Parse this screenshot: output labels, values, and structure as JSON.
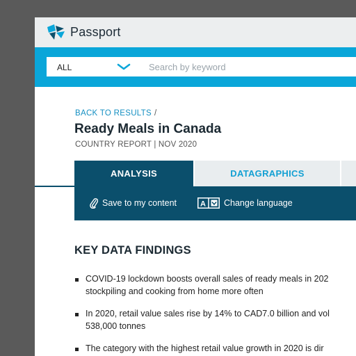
{
  "brand": {
    "name": "Passport"
  },
  "search": {
    "category": "ALL",
    "placeholder": "Search by keyword"
  },
  "breadcrumb": {
    "back_label": "BACK TO RESULTS",
    "separator": "/"
  },
  "report": {
    "title": "Ready Meals in Canada",
    "meta": "COUNTRY REPORT | NOV 2020"
  },
  "tabs": [
    {
      "label": "ANALYSIS",
      "active": true
    },
    {
      "label": "DATAGRAPHICS",
      "active": false
    }
  ],
  "actions": {
    "save": "Save to my content",
    "language": "Change language"
  },
  "section": {
    "heading": "KEY DATA FINDINGS"
  },
  "findings": [
    {
      "line1": "COVID-19 lockdown boosts overall sales of ready meals in 202",
      "line2": "stockpiling and cooking from home more often"
    },
    {
      "line1": "In 2020, retail value sales rise by 14% to CAD7.0 billion and vol",
      "line2": "538,000 tonnes"
    },
    {
      "line1": "The category with the highest retail value growth in 2020 is dir",
      "line2": ""
    }
  ],
  "colors": {
    "accent": "#0aa6d9",
    "dark_teal": "#0b4f6c",
    "link": "#148fc2",
    "tab_inactive_bg": "#e9edef"
  }
}
